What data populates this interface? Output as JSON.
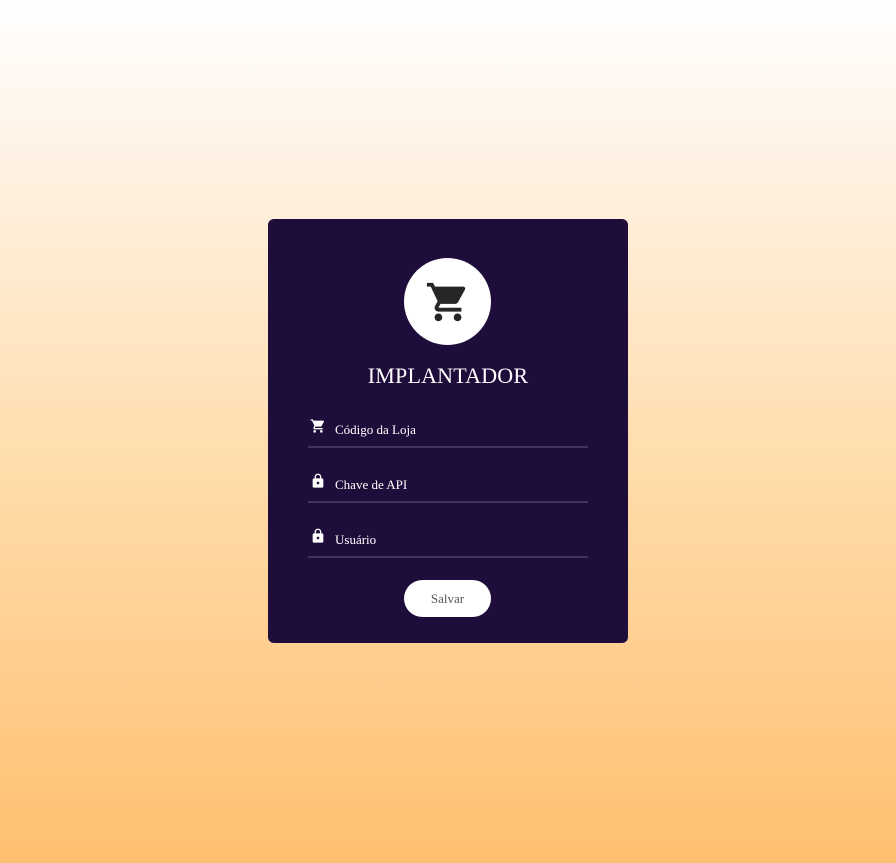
{
  "login_card": {
    "logo_icon": "shopping-cart-icon",
    "title": "IMPLANTADOR",
    "fields": [
      {
        "icon": "shopping-cart-icon",
        "placeholder": "Código da Loja",
        "value": ""
      },
      {
        "icon": "lock-icon",
        "placeholder": "Chave de API",
        "value": ""
      },
      {
        "icon": "lock-icon",
        "placeholder": "Usuário",
        "value": ""
      }
    ],
    "save_label": "Salvar"
  },
  "colors": {
    "card_background": "#1e0d3a",
    "field_underline": "#3f3360",
    "button_background": "#ffffff",
    "gradient_top": "#ffffff",
    "gradient_bottom": "#ffbf70"
  }
}
